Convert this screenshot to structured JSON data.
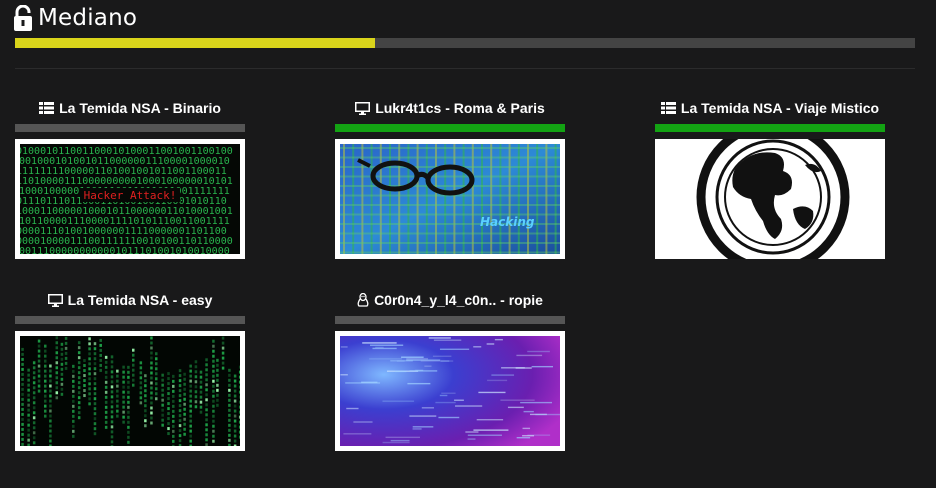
{
  "header": {
    "title": "Mediano",
    "lock_icon": "unlock-icon"
  },
  "progress": {
    "fraction": 0.4,
    "fill_color": "#d9d41b",
    "track_color": "#444444"
  },
  "colors": {
    "solved": "#13a313",
    "unsolved": "#555555",
    "background": "#19191a"
  },
  "machines": [
    {
      "name": "La Temida NSA - Binario",
      "icon": "grid-icon",
      "solved": false,
      "image": "binary-hacker-attack",
      "image_text": "Hacker Attack!"
    },
    {
      "name": "Lukr4t1cs - Roma & Paris",
      "icon": "monitor-icon",
      "solved": true,
      "image": "glasses-hacking",
      "image_text": "Hacking"
    },
    {
      "name": "La Temida NSA - Viaje Mistico",
      "icon": "grid-icon",
      "solved": true,
      "image": "globe-rings"
    },
    {
      "name": "La Temida NSA - easy",
      "icon": "monitor-icon",
      "solved": false,
      "image": "green-code-rain"
    },
    {
      "name": "C0r0n4_y_l4_c0n.. - ropie",
      "icon": "linux-icon",
      "solved": false,
      "image": "purple-blur-code"
    }
  ]
}
